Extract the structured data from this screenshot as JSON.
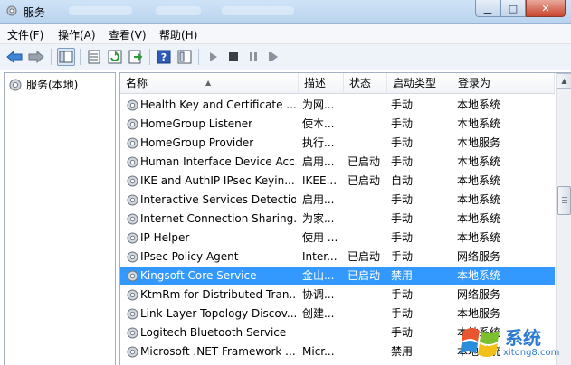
{
  "window": {
    "title": "服务"
  },
  "menu": [
    "文件(F)",
    "操作(A)",
    "查看(V)",
    "帮助(H)"
  ],
  "toolbar": [
    "back-icon",
    "forward-icon",
    "show-tree-icon",
    "properties-icon",
    "refresh-icon",
    "export-icon",
    "help-icon",
    "view-icon",
    "play-icon",
    "stop-icon",
    "pause-icon",
    "restart-icon"
  ],
  "tree": {
    "root": "服务(本地)"
  },
  "columns": {
    "name": "名称",
    "desc": "描述",
    "state": "状态",
    "startup": "启动类型",
    "logon": "登录为"
  },
  "services": [
    {
      "name": "Health Key and Certificate ...",
      "desc": "为网...",
      "state": "",
      "startup": "手动",
      "logon": "本地系统"
    },
    {
      "name": "HomeGroup Listener",
      "desc": "使本...",
      "state": "",
      "startup": "手动",
      "logon": "本地系统"
    },
    {
      "name": "HomeGroup Provider",
      "desc": "执行...",
      "state": "",
      "startup": "手动",
      "logon": "本地服务"
    },
    {
      "name": "Human Interface Device Acc...",
      "desc": "启用...",
      "state": "已启动",
      "startup": "手动",
      "logon": "本地系统"
    },
    {
      "name": "IKE and AuthIP IPsec Keyin...",
      "desc": "IKEE...",
      "state": "已启动",
      "startup": "自动",
      "logon": "本地系统"
    },
    {
      "name": "Interactive Services Detection",
      "desc": "启用...",
      "state": "",
      "startup": "手动",
      "logon": "本地系统"
    },
    {
      "name": "Internet Connection Sharing...",
      "desc": "为家...",
      "state": "",
      "startup": "手动",
      "logon": "本地系统"
    },
    {
      "name": "IP Helper",
      "desc": "使用 ...",
      "state": "",
      "startup": "手动",
      "logon": "本地系统"
    },
    {
      "name": "IPsec Policy Agent",
      "desc": "Inter...",
      "state": "已启动",
      "startup": "手动",
      "logon": "网络服务"
    },
    {
      "name": "Kingsoft Core Service",
      "desc": "金山...",
      "state": "已启动",
      "startup": "禁用",
      "logon": "本地系统",
      "selected": true
    },
    {
      "name": "KtmRm for Distributed Tran...",
      "desc": "协调...",
      "state": "",
      "startup": "手动",
      "logon": "网络服务"
    },
    {
      "name": "Link-Layer Topology Discov...",
      "desc": "创建...",
      "state": "",
      "startup": "手动",
      "logon": "本地服务"
    },
    {
      "name": "Logitech Bluetooth Service",
      "desc": "",
      "state": "",
      "startup": "手动",
      "logon": "本地系统"
    },
    {
      "name": "Microsoft .NET Framework ...",
      "desc": "Micr...",
      "state": "",
      "startup": "禁用",
      "logon": "本地系统"
    }
  ],
  "watermark": {
    "text": "系统",
    "url": "xitong8.com"
  },
  "colors": {
    "selection": "#3399ff",
    "titlebar": "#cfe3f7"
  }
}
